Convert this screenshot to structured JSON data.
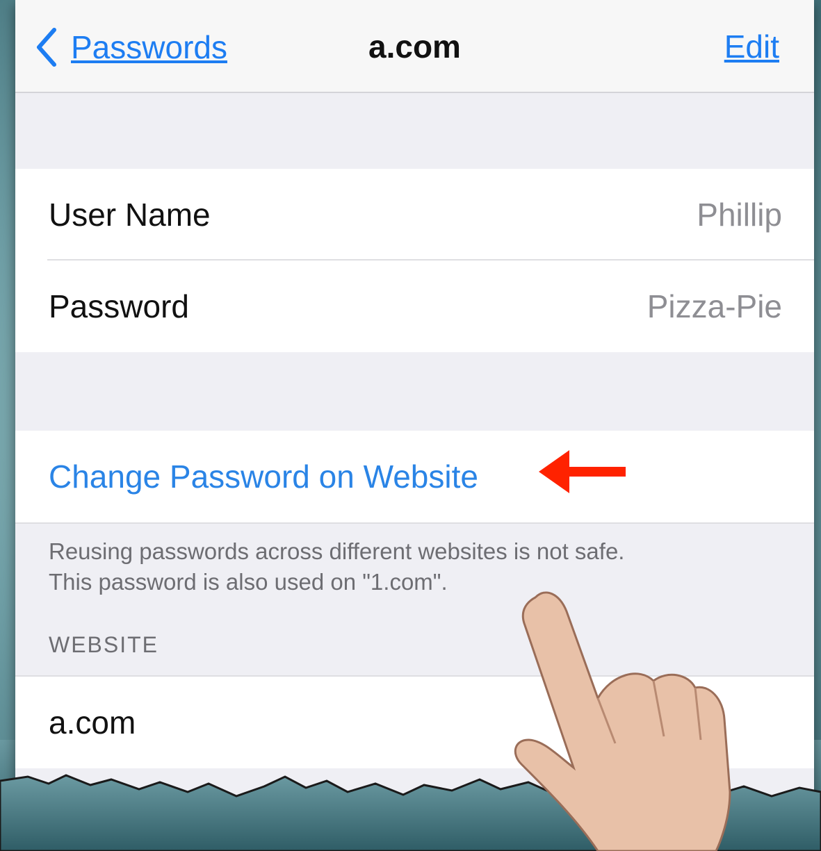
{
  "nav": {
    "back_label": "Passwords",
    "title": "a.com",
    "edit_label": "Edit"
  },
  "credentials": {
    "rows": [
      {
        "label": "User Name",
        "value": "Phillip"
      },
      {
        "label": "Password",
        "value": "Pizza-Pie"
      }
    ]
  },
  "actions": {
    "change_password_label": "Change Password on Website"
  },
  "warning": {
    "line1": "Reusing passwords across different websites is not safe.",
    "line2": "This password is also used on \"1.com\"."
  },
  "website_section": {
    "header": "WEBSITE",
    "value": "a.com"
  },
  "icons": {
    "back": "chevron-left-icon",
    "annotation_arrow": "red-arrow-icon",
    "pointer": "pointing-hand-icon"
  },
  "colors": {
    "accent": "#1d7df2",
    "annotation": "#ff2200"
  }
}
